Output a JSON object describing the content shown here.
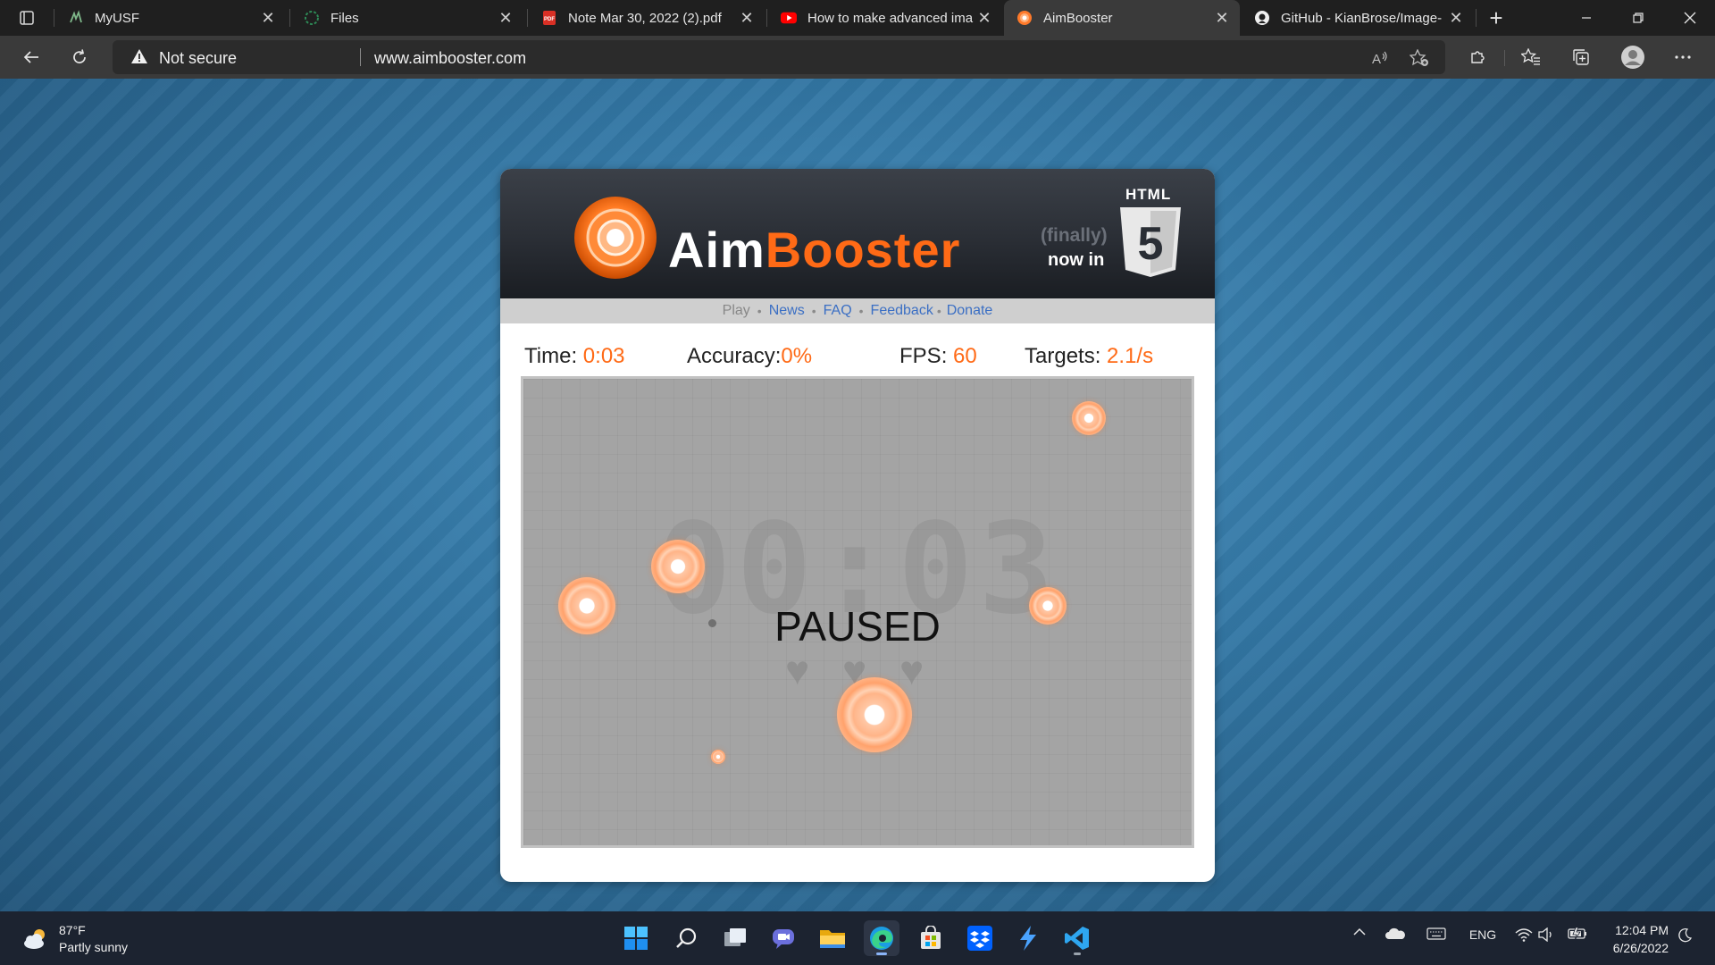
{
  "browser": {
    "tabs": [
      {
        "title": "MyUSF",
        "icon": "myusf-icon",
        "active": false
      },
      {
        "title": "Files",
        "icon": "files-icon",
        "active": false
      },
      {
        "title": "Note Mar 30, 2022 (2).pdf",
        "icon": "pdf-icon",
        "active": false
      },
      {
        "title": "How to make advanced ima",
        "icon": "youtube-icon",
        "active": false
      },
      {
        "title": "AimBooster",
        "icon": "aimbooster-icon",
        "active": true
      },
      {
        "title": "GitHub - KianBrose/Image-",
        "icon": "github-icon",
        "active": false
      }
    ],
    "address_bar": {
      "security_label": "Not secure",
      "url": "www.aimbooster.com"
    }
  },
  "site": {
    "logo": {
      "part1": "Aim",
      "part2": "Booster"
    },
    "html5_badge": {
      "finally": "(finally)",
      "now_in": "now in",
      "label": "HTML",
      "number": "5"
    },
    "nav": {
      "items": [
        "Play",
        "News",
        "FAQ",
        "Feedback",
        "Donate"
      ],
      "current": "Play"
    },
    "stats": {
      "time_label": "Time",
      "time_value": "0:03",
      "accuracy_label": "Accuracy",
      "accuracy_value": "0%",
      "fps_label": "FPS",
      "fps_value": "60",
      "targets_label": "Targets",
      "targets_value": "2.1/s"
    },
    "game": {
      "big_timer": "00:03",
      "status": "PAUSED",
      "lives": 3
    }
  },
  "taskbar": {
    "weather": {
      "temp": "87°F",
      "condition": "Partly sunny"
    },
    "language": "ENG",
    "time": "12:04 PM",
    "date": "6/26/2022"
  },
  "colors": {
    "accent_orange": "#ff6a16",
    "link_blue": "#3b6fc4",
    "browser_dark": "#1f1f1f",
    "taskbar": "#1c2330"
  }
}
